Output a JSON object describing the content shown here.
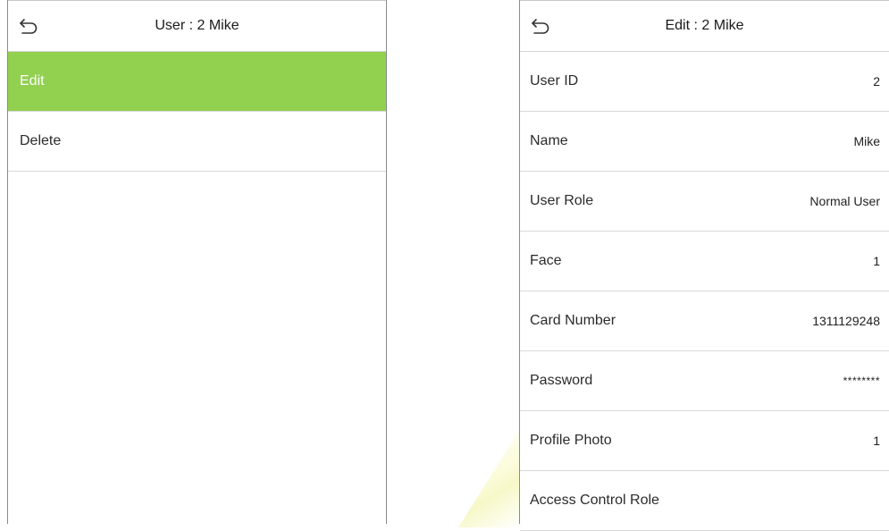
{
  "left_screen": {
    "title": "User : 2 Mike",
    "menu": [
      {
        "label": "Edit",
        "selected": true
      },
      {
        "label": "Delete",
        "selected": false
      }
    ]
  },
  "right_screen": {
    "title": "Edit : 2 Mike",
    "fields": [
      {
        "label": "User ID",
        "value": "2"
      },
      {
        "label": "Name",
        "value": "Mike"
      },
      {
        "label": "User Role",
        "value": "Normal User"
      },
      {
        "label": "Face",
        "value": "1"
      },
      {
        "label": "Card Number",
        "value": "1311129248"
      },
      {
        "label": "Password",
        "value": "********"
      },
      {
        "label": "Profile Photo",
        "value": "1"
      },
      {
        "label": "Access Control Role",
        "value": ""
      }
    ]
  },
  "colors": {
    "selected": "#92d050",
    "divider": "#d9d9d9"
  },
  "icons": {
    "back": "back-arrow-icon"
  }
}
